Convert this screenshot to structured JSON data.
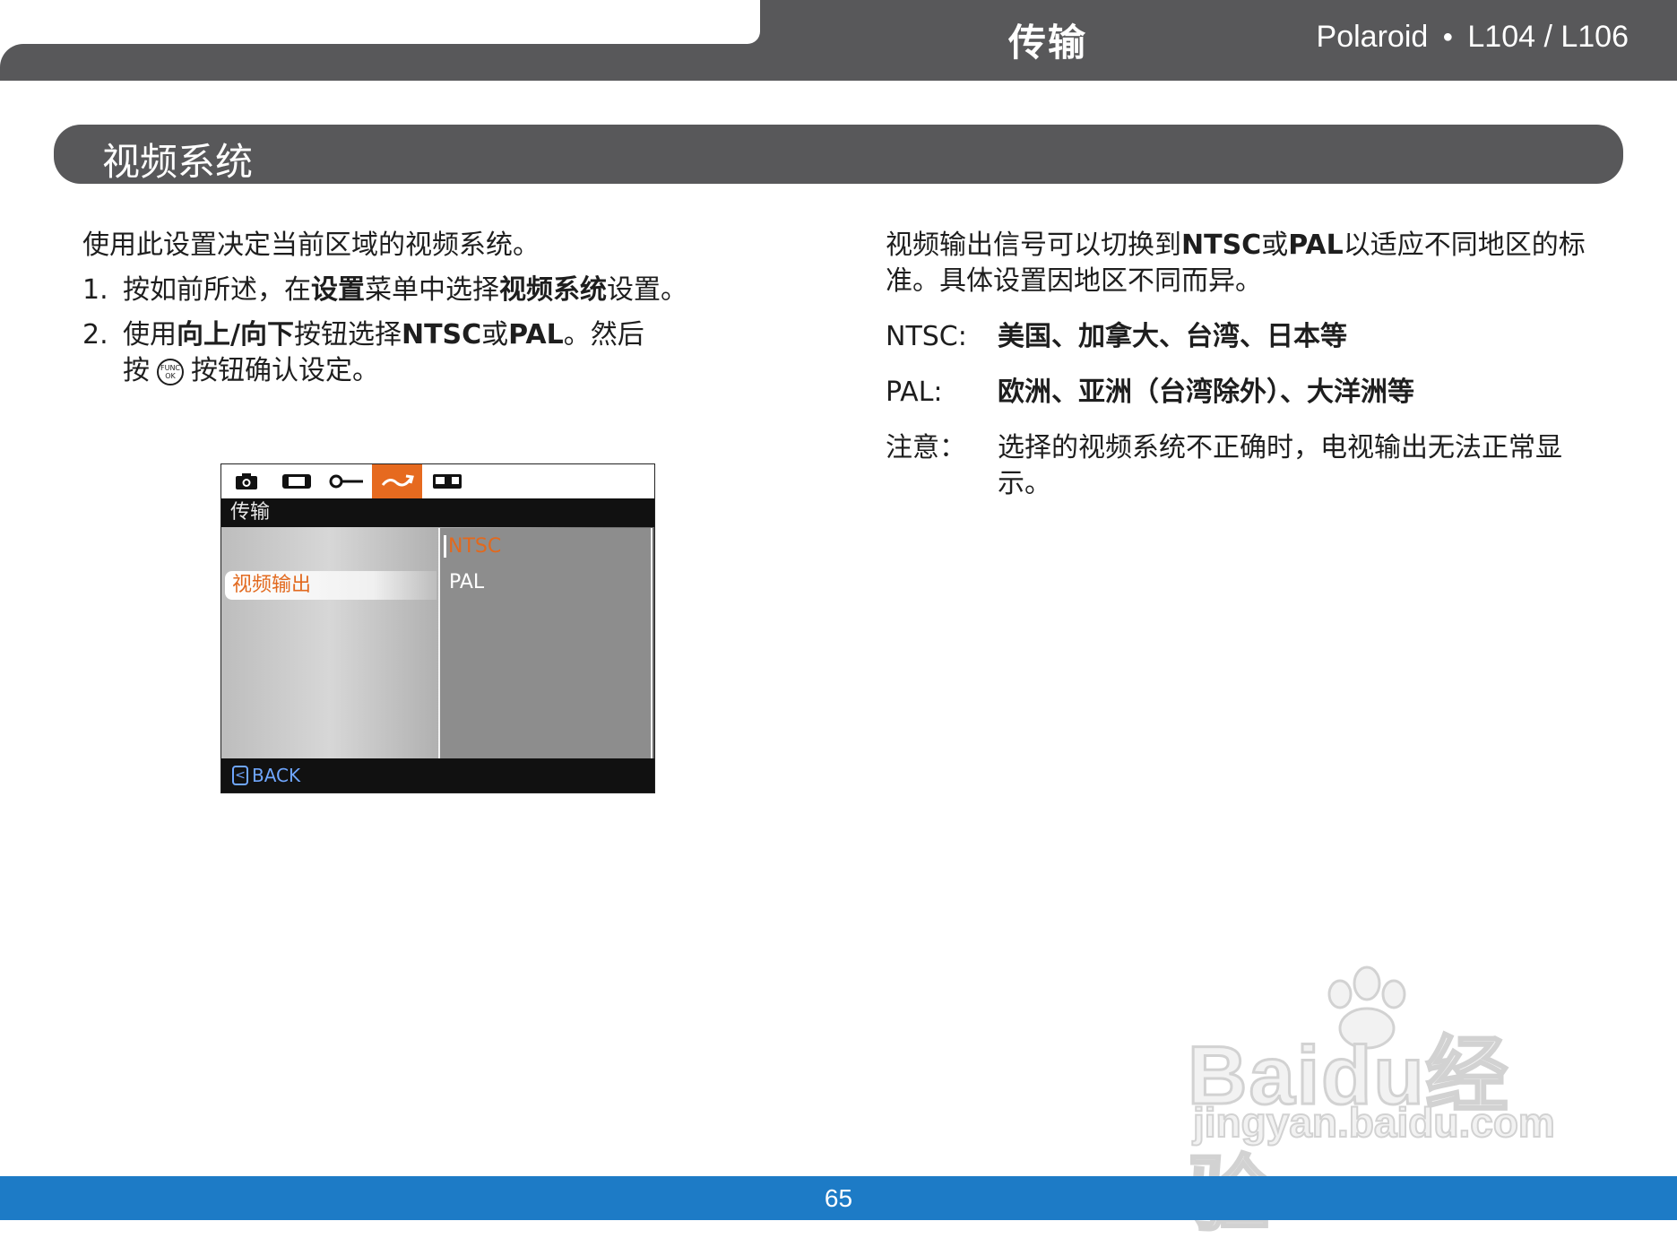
{
  "header": {
    "title": "传输",
    "brand": "Polaroid",
    "model": "L104 / L106"
  },
  "section": {
    "title": "视频系统"
  },
  "left": {
    "intro": "使用此设置决定当前区域的视频系统。",
    "step1": {
      "num": "1.",
      "t1": "按如前所述，在",
      "b1": "设置",
      "t2": "菜单中选择",
      "b2": "视频系统",
      "t3": "设置。"
    },
    "step2": {
      "num": "2.",
      "t1": "使用",
      "b1": "向上/向下",
      "t2": "按钮选择",
      "b2": "NTSC",
      "t3": "或",
      "b3": "PAL",
      "t4": "。然后",
      "t5": "按",
      "t6": "按钮确认设定。",
      "icon_top": "FUNC",
      "icon_bottom": "OK"
    }
  },
  "screen": {
    "title": "传输",
    "selected_item": "视频输出",
    "options": [
      "NTSC",
      "PAL"
    ],
    "selected_option": "NTSC",
    "back_label": "BACK",
    "accent_color": "#e66a1f",
    "tabs": [
      "camera-icon",
      "film-icon",
      "key-icon",
      "transfer-icon",
      "playback-icon"
    ]
  },
  "right": {
    "p1a": "视频输出信号可以切换到",
    "p1b": "NTSC",
    "p1c": "或",
    "p1d": "PAL",
    "p1e": "以适应不同地区的标准。具体设置因地区不同而异。",
    "ntsc_label": "NTSC:",
    "ntsc_value": "美国、加拿大、台湾、日本等",
    "pal_label": "PAL:",
    "pal_value": "欧洲、亚洲（台湾除外）、大洋洲等",
    "note_label": "注意：",
    "note_value": "选择的视频系统不正确时，电视输出无法正常显示。"
  },
  "watermark": {
    "main": "Baidu经验",
    "sub": "jingyan.baidu.com"
  },
  "footer": {
    "page_number": "65"
  },
  "colors": {
    "header_gray": "#58585a",
    "footer_blue": "#1d7bc6",
    "accent_orange": "#e66a1f"
  }
}
